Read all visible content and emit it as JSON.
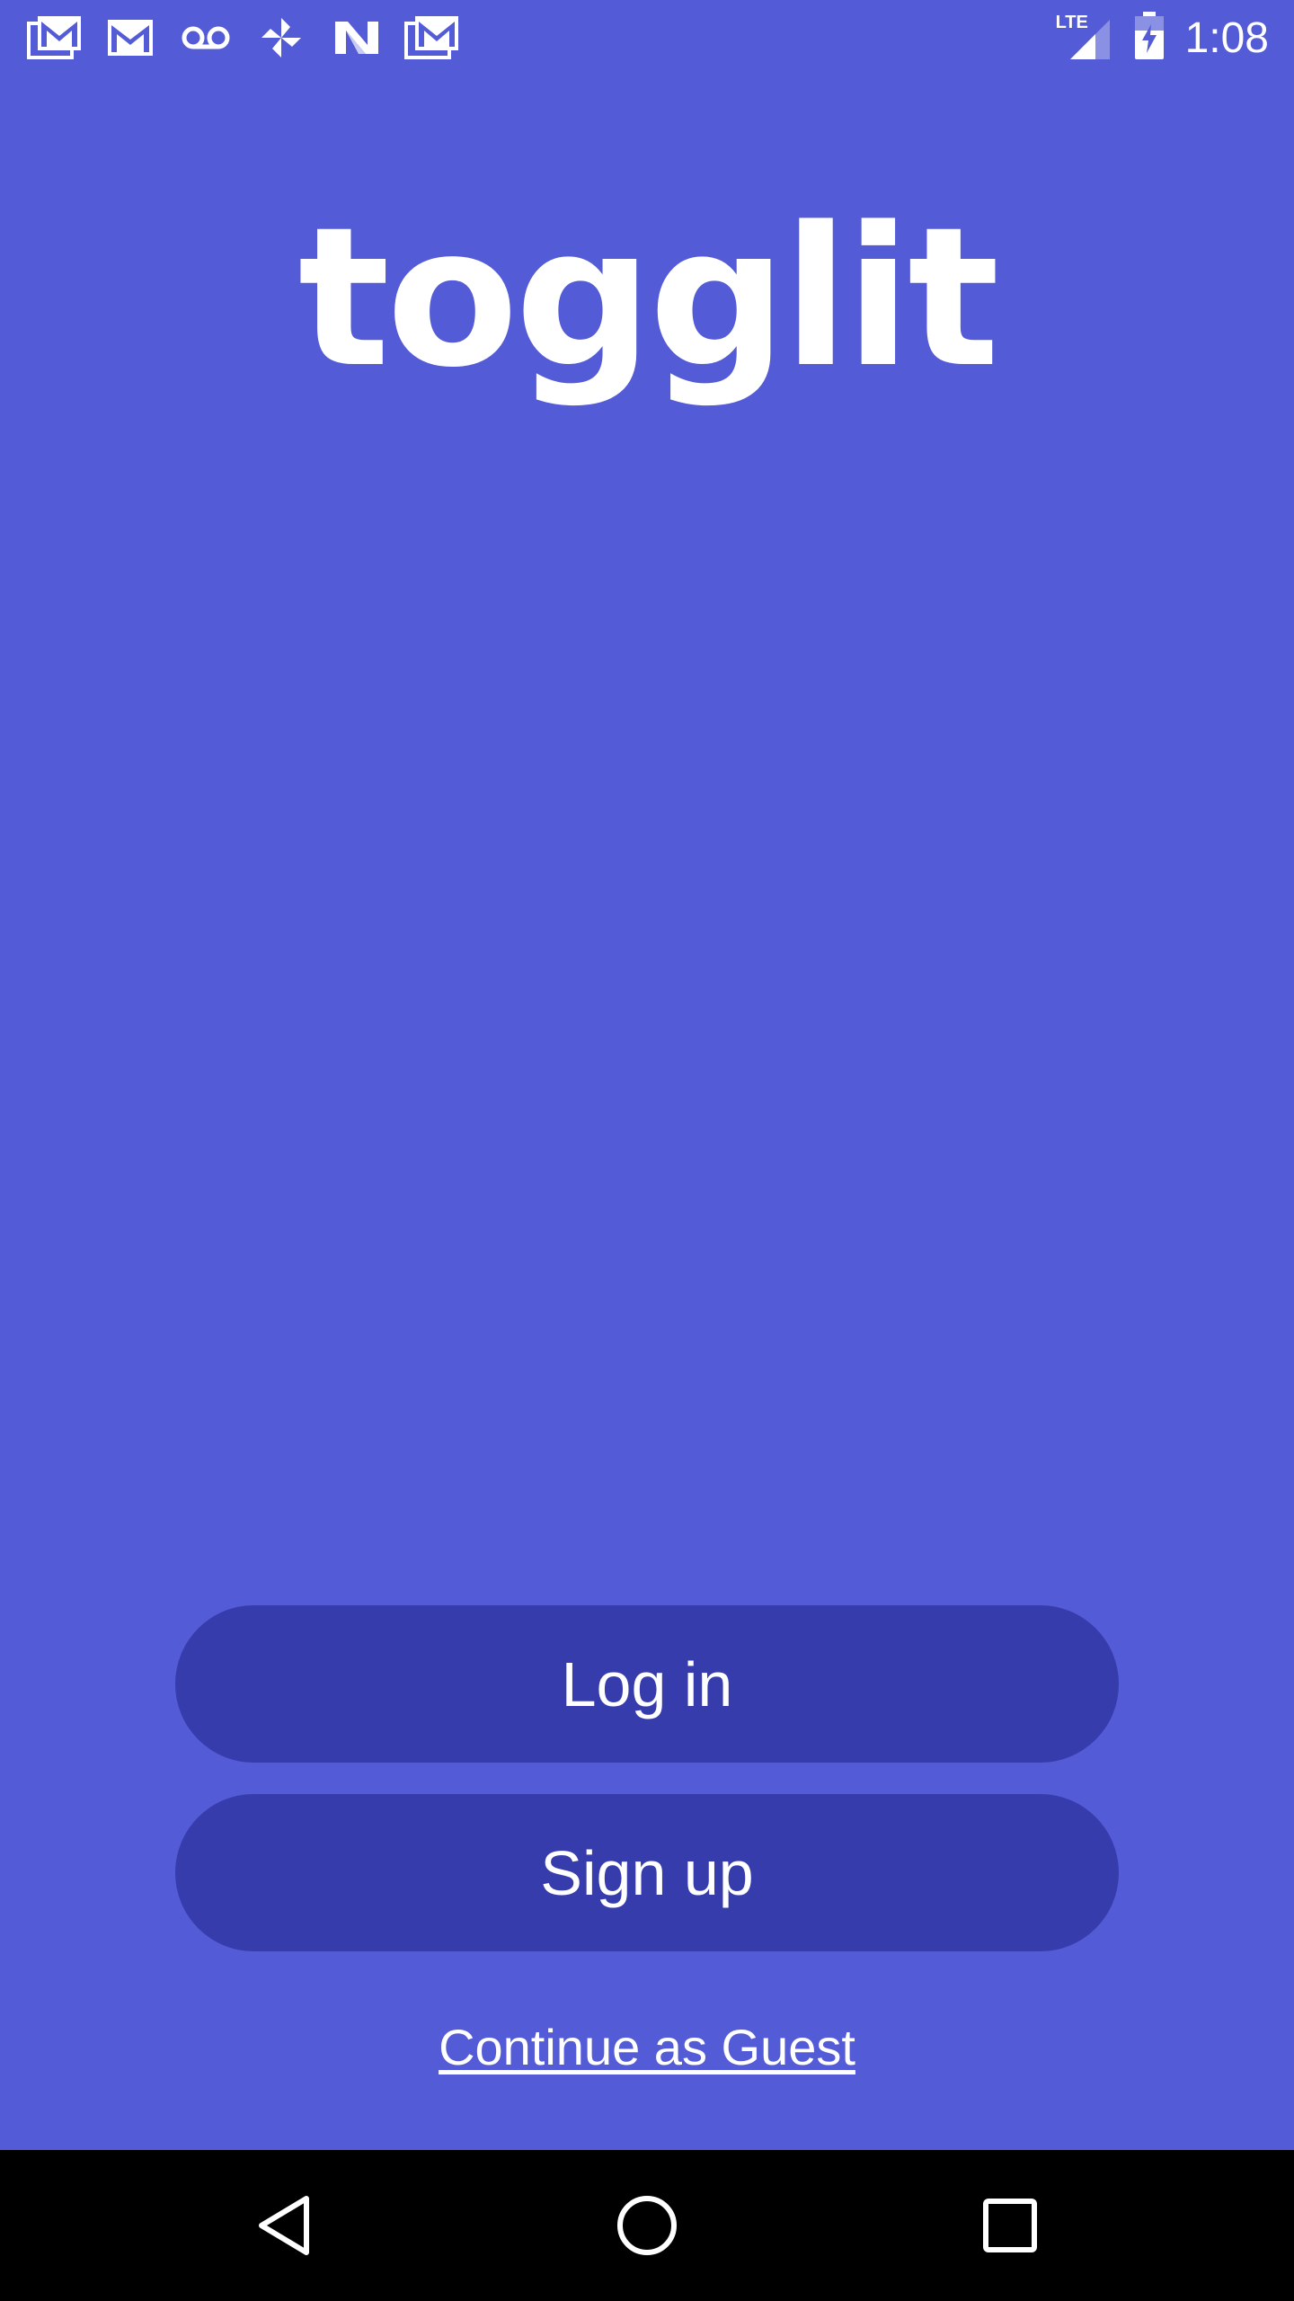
{
  "status_bar": {
    "time": "1:08",
    "network": "LTE",
    "notification_icons": [
      "gmail-stack-icon",
      "gmail-icon",
      "voicemail-icon",
      "pinwheel-icon",
      "n-app-icon",
      "gmail-stack-icon"
    ],
    "system_icons": [
      "lte-signal-icon",
      "battery-charging-icon"
    ]
  },
  "logo": {
    "text": "togglit"
  },
  "buttons": {
    "login_label": "Log in",
    "signup_label": "Sign up",
    "guest_label": "Continue as Guest"
  },
  "nav_bar": {
    "icons": [
      "back-icon",
      "home-icon",
      "recents-icon"
    ]
  },
  "colors": {
    "background": "#535BD6",
    "button": "#363CAC",
    "text": "#FFFFFF",
    "nav_bar": "#000000"
  }
}
